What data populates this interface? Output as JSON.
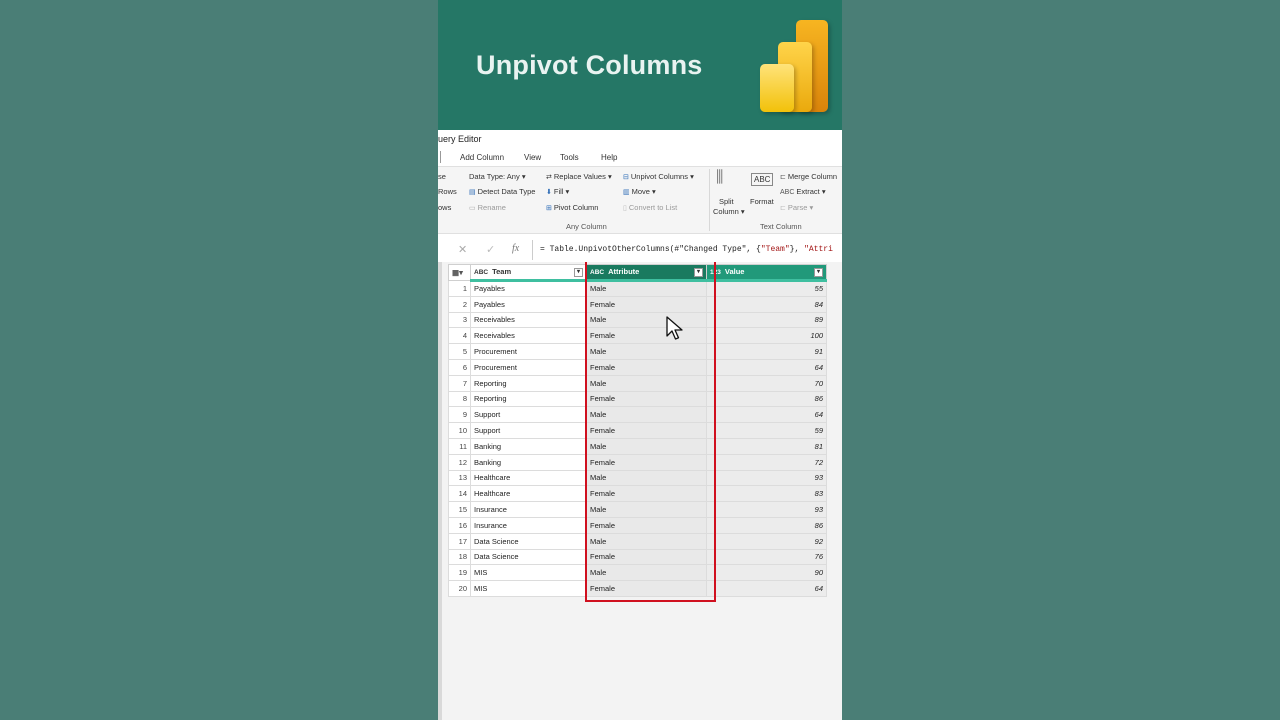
{
  "banner": {
    "title": "Unpivot Columns"
  },
  "window": {
    "title": "uery Editor"
  },
  "tabs": [
    {
      "label": "Add Column"
    },
    {
      "label": "View"
    },
    {
      "label": "Tools"
    },
    {
      "label": "Help"
    }
  ],
  "ribbon": {
    "left_cut": [
      "se",
      "Rows",
      "ows"
    ],
    "data_type": "Data Type: Any",
    "detect_type": "Detect Data Type",
    "rename": "Rename",
    "replace_values": "Replace Values",
    "fill": "Fill",
    "pivot_column": "Pivot Column",
    "unpivot_columns": "Unpivot Columns",
    "move": "Move",
    "convert_to_list": "Convert to List",
    "any_column_group": "Any Column",
    "split_column": "Split",
    "split_column2": "Column",
    "format": "Format",
    "merge_columns": "Merge Column",
    "extract": "Extract",
    "parse": "Parse",
    "text_column_group": "Text Column"
  },
  "formula": {
    "text_prefix": "= Table.UnpivotOtherColumns(#\"Changed Type\", {",
    "text_str": "\"Team\"",
    "text_mid": "}, ",
    "text_str2": "\"Attri"
  },
  "table": {
    "headers": {
      "team": "Team",
      "attribute": "Attribute",
      "value": "Value"
    },
    "rows": [
      {
        "n": "1",
        "team": "Payables",
        "attr": "Male",
        "val": "55"
      },
      {
        "n": "2",
        "team": "Payables",
        "attr": "Female",
        "val": "84"
      },
      {
        "n": "3",
        "team": "Receivables",
        "attr": "Male",
        "val": "89"
      },
      {
        "n": "4",
        "team": "Receivables",
        "attr": "Female",
        "val": "100"
      },
      {
        "n": "5",
        "team": "Procurement",
        "attr": "Male",
        "val": "91"
      },
      {
        "n": "6",
        "team": "Procurement",
        "attr": "Female",
        "val": "64"
      },
      {
        "n": "7",
        "team": "Reporting",
        "attr": "Male",
        "val": "70"
      },
      {
        "n": "8",
        "team": "Reporting",
        "attr": "Female",
        "val": "86"
      },
      {
        "n": "9",
        "team": "Support",
        "attr": "Male",
        "val": "64"
      },
      {
        "n": "10",
        "team": "Support",
        "attr": "Female",
        "val": "59"
      },
      {
        "n": "11",
        "team": "Banking",
        "attr": "Male",
        "val": "81"
      },
      {
        "n": "12",
        "team": "Banking",
        "attr": "Female",
        "val": "72"
      },
      {
        "n": "13",
        "team": "Healthcare",
        "attr": "Male",
        "val": "93"
      },
      {
        "n": "14",
        "team": "Healthcare",
        "attr": "Female",
        "val": "83"
      },
      {
        "n": "15",
        "team": "Insurance",
        "attr": "Male",
        "val": "93"
      },
      {
        "n": "16",
        "team": "Insurance",
        "attr": "Female",
        "val": "86"
      },
      {
        "n": "17",
        "team": "Data Science",
        "attr": "Male",
        "val": "92"
      },
      {
        "n": "18",
        "team": "Data Science",
        "attr": "Female",
        "val": "76"
      },
      {
        "n": "19",
        "team": "MIS",
        "attr": "Male",
        "val": "90"
      },
      {
        "n": "20",
        "team": "MIS",
        "attr": "Female",
        "val": "64"
      }
    ]
  },
  "colors": {
    "banner": "#257766",
    "attribute_header": "#1a7a5f",
    "value_header": "#21997a",
    "highlight": "#d0101f"
  }
}
